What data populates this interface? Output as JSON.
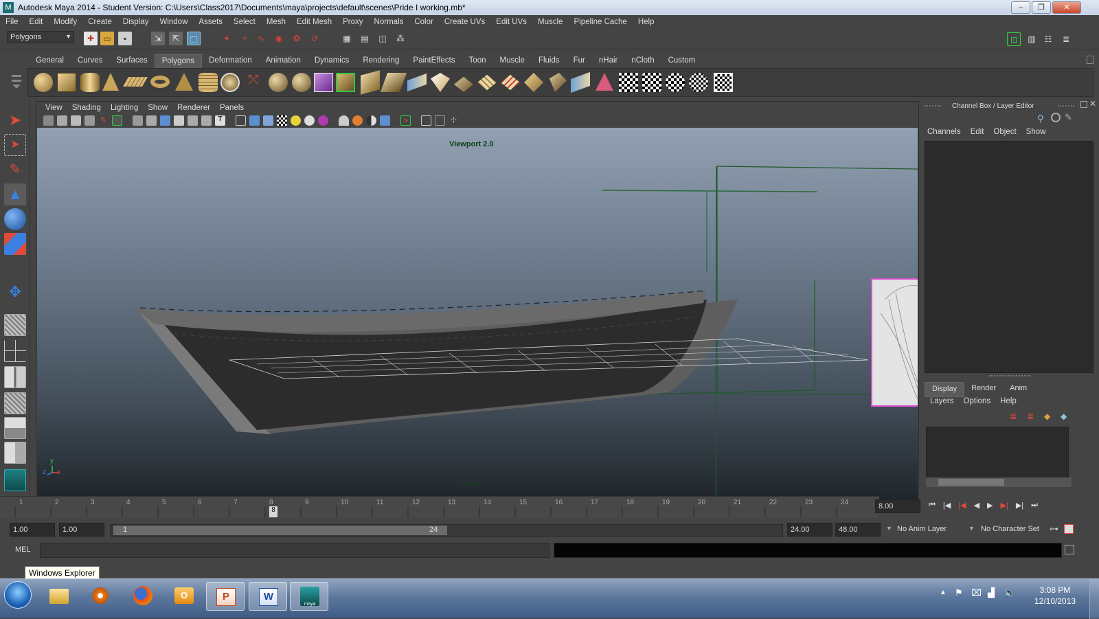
{
  "window": {
    "title": "Autodesk Maya 2014 - Student Version: C:\\Users\\Class2017\\Documents\\maya\\projects\\default\\scenes\\Pride I working.mb*",
    "app_icon": "M"
  },
  "menubar": [
    "File",
    "Edit",
    "Modify",
    "Create",
    "Display",
    "Window",
    "Assets",
    "Select",
    "Mesh",
    "Edit Mesh",
    "Proxy",
    "Normals",
    "Color",
    "Create UVs",
    "Edit UVs",
    "Muscle",
    "Pipeline Cache",
    "Help"
  ],
  "statusline": {
    "menuset": "Polygons"
  },
  "shelf_tabs": [
    "General",
    "Curves",
    "Surfaces",
    "Polygons",
    "Deformation",
    "Animation",
    "Dynamics",
    "Rendering",
    "PaintEffects",
    "Toon",
    "Muscle",
    "Fluids",
    "Fur",
    "nHair",
    "nCloth",
    "Custom"
  ],
  "shelf_active": "Polygons",
  "viewport": {
    "menu": [
      "View",
      "Shading",
      "Lighting",
      "Show",
      "Renderer",
      "Panels"
    ],
    "renderer_label": "Viewport 2.0",
    "camera_label": "persp",
    "axis_y": "y",
    "axis_x": "x",
    "axis_z": "z"
  },
  "channel_box": {
    "title": "Channel Box / Layer Editor",
    "menu": [
      "Channels",
      "Edit",
      "Object",
      "Show"
    ]
  },
  "layer_editor": {
    "tabs": [
      "Display",
      "Render",
      "Anim"
    ],
    "menu": [
      "Layers",
      "Options",
      "Help"
    ]
  },
  "timeline": {
    "ticks": [
      "1",
      "2",
      "3",
      "4",
      "5",
      "6",
      "7",
      "8",
      "9",
      "10",
      "11",
      "12",
      "13",
      "14",
      "15",
      "16",
      "17",
      "18",
      "19",
      "20",
      "21",
      "22",
      "23",
      "24"
    ],
    "current_frame_marker": "8",
    "current_time": "8.00"
  },
  "range": {
    "start": "1.00",
    "anim_start": "1.00",
    "slider_start": "1",
    "slider_end": "24",
    "anim_end": "24.00",
    "end": "48.00",
    "anim_layer": "No Anim Layer",
    "character_set": "No Character Set"
  },
  "command_line": {
    "label": "MEL"
  },
  "tooltip": "Windows Explorer",
  "taskbar": {
    "time": "3:08 PM",
    "date": "12/10/2013",
    "maya_label": "maya"
  },
  "colors": {
    "viewport_top": "#92a0b2",
    "viewport_bottom": "#1e2328",
    "ui_bg": "#444444",
    "grid_green": "#1e5a2c",
    "highlight_magenta": "#d94fd0"
  }
}
